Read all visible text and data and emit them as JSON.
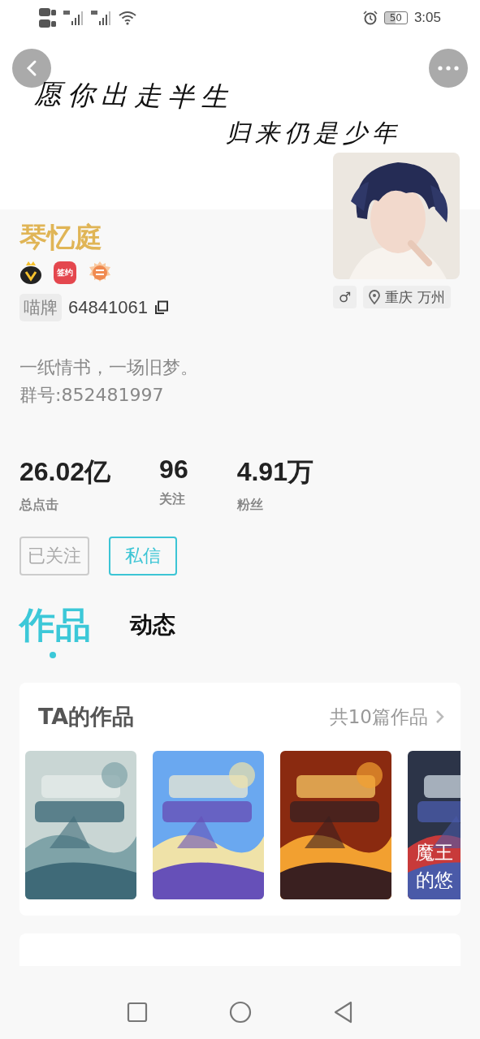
{
  "status_bar": {
    "battery": "50",
    "time": "3:05"
  },
  "banner": {
    "lines": [
      "愿你出走半生",
      "归来仍是少年"
    ]
  },
  "profile": {
    "name": "琴忆庭",
    "badges": [
      {
        "kind": "vip"
      },
      {
        "kind": "signed",
        "label": "签约"
      },
      {
        "kind": "medal"
      }
    ],
    "id_label": "喵牌",
    "id_value": "64841061",
    "gender_symbol": "♂",
    "location": "重庆 万州",
    "bio": [
      "一纸情书，一场旧梦。",
      "群号:852481997"
    ]
  },
  "stats": [
    {
      "value": "26.02亿",
      "label": "总点击"
    },
    {
      "value": "96",
      "label": "关注"
    },
    {
      "value": "4.91万",
      "label": "粉丝"
    }
  ],
  "actions": {
    "follow": {
      "label": "已关注",
      "followed": true
    },
    "message": {
      "label": "私信"
    }
  },
  "tabs": [
    {
      "label": "作品",
      "selected": true
    },
    {
      "label": "动态",
      "selected": false
    }
  ],
  "works_card": {
    "title": "TA的作品",
    "more": "共10篇作品",
    "covers": [
      {
        "kind": "picture"
      },
      {
        "kind": "picture"
      },
      {
        "kind": "picture"
      },
      {
        "kind": "picture",
        "title_lines": [
          "魔王",
          "的悠"
        ]
      }
    ]
  },
  "next_card": {
    "kind": "card"
  }
}
